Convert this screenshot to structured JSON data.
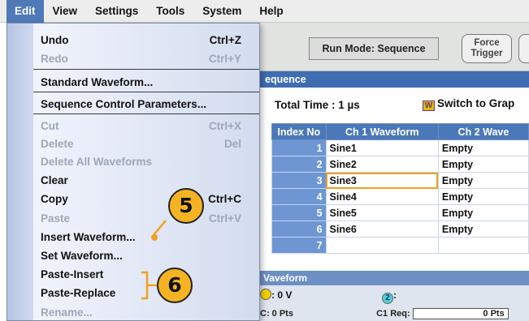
{
  "menubar": {
    "items": [
      "Edit",
      "View",
      "Settings",
      "Tools",
      "System",
      "Help"
    ]
  },
  "toolbar": {
    "run_mode": "Run Mode: Sequence",
    "force_trigger_line1": "Force",
    "force_trigger_line2": "Trigger"
  },
  "sequence": {
    "header": "equence",
    "total_time": "Total Time : 1 µs",
    "switch_label": "Switch to Grap",
    "switch_icon_glyph": "W",
    "columns": [
      "Index No",
      "Ch 1 Waveform",
      "Ch 2 Wave"
    ],
    "rows": [
      {
        "index": "1",
        "ch1": "Sine1",
        "ch2": "Empty"
      },
      {
        "index": "2",
        "ch1": "Sine2",
        "ch2": "Empty"
      },
      {
        "index": "3",
        "ch1": "Sine3",
        "ch2": "Empty"
      },
      {
        "index": "4",
        "ch1": "Sine4",
        "ch2": "Empty"
      },
      {
        "index": "5",
        "ch1": "Sine5",
        "ch2": "Empty"
      },
      {
        "index": "6",
        "ch1": "Sine6",
        "ch2": "Empty"
      },
      {
        "index": "7",
        "ch1": "",
        "ch2": ""
      }
    ],
    "selected_row_index": 2
  },
  "waveform_panel": {
    "header": "Vaveform",
    "ch1_value": ": 0 V",
    "ch2_glyph": "2",
    "ch2_label": ":",
    "points_left": "C: 0 Pts",
    "c1_req_label": "C1 Req:",
    "pts_value": "0 Pts"
  },
  "edit_menu": {
    "items": [
      {
        "label": "Undo",
        "shortcut": "Ctrl+Z",
        "enabled": true
      },
      {
        "label": "Redo",
        "shortcut": "Ctrl+Y",
        "enabled": false
      },
      {
        "label": "Standard Waveform...",
        "shortcut": "",
        "enabled": true
      },
      {
        "label": "Sequence Control Parameters...",
        "shortcut": "",
        "enabled": true
      },
      {
        "label": "Cut",
        "shortcut": "Ctrl+X",
        "enabled": false
      },
      {
        "label": "Delete",
        "shortcut": "Del",
        "enabled": false
      },
      {
        "label": "Delete All Waveforms",
        "shortcut": "",
        "enabled": false
      },
      {
        "label": "Clear",
        "shortcut": "",
        "enabled": true
      },
      {
        "label": "Copy",
        "shortcut": "Ctrl+C",
        "enabled": true
      },
      {
        "label": "Paste",
        "shortcut": "Ctrl+V",
        "enabled": false
      },
      {
        "label": "Insert Waveform...",
        "shortcut": "",
        "enabled": true
      },
      {
        "label": "Set Waveform...",
        "shortcut": "",
        "enabled": true
      },
      {
        "label": "Paste-Insert",
        "shortcut": "",
        "enabled": true
      },
      {
        "label": "Paste-Replace",
        "shortcut": "",
        "enabled": true
      },
      {
        "label": "Rename...",
        "shortcut": "",
        "enabled": false
      }
    ]
  },
  "callouts": {
    "step5": "5",
    "step6": "6"
  },
  "colors": {
    "menu_highlight": "#4f79b8",
    "table_header": "#4b78b8",
    "callout_fill": "#f5b324",
    "selection_outline": "#f0a020"
  }
}
